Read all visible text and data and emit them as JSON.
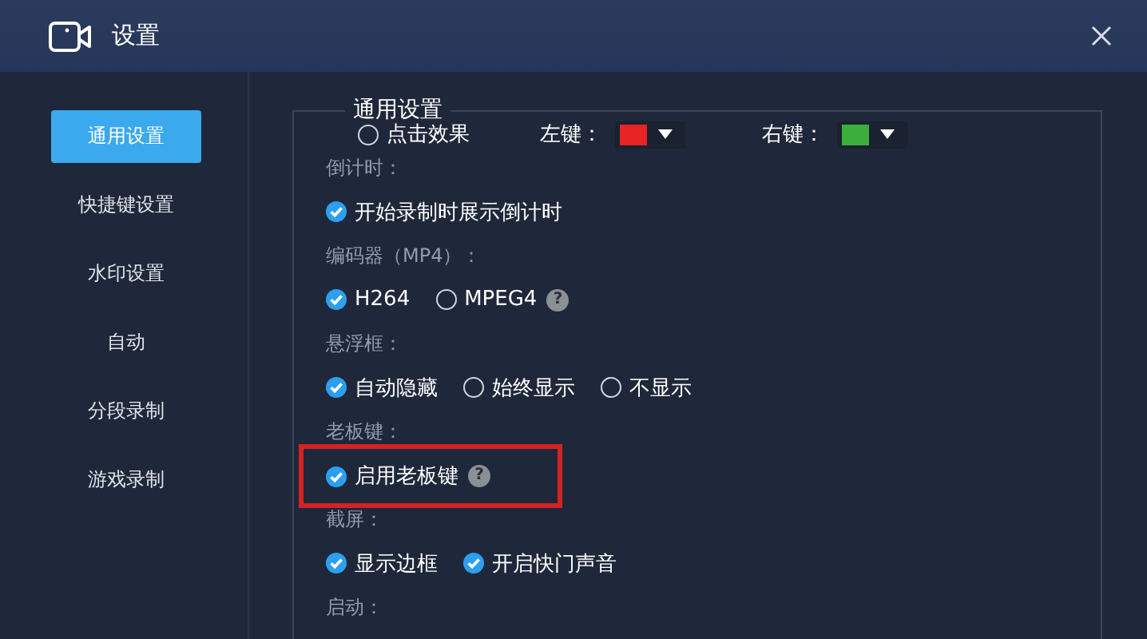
{
  "window": {
    "title": "设置"
  },
  "sidebar": {
    "items": [
      {
        "label": "通用设置",
        "selected": true
      },
      {
        "label": "快捷键设置",
        "selected": false
      },
      {
        "label": "水印设置",
        "selected": false
      },
      {
        "label": "自动",
        "selected": false
      },
      {
        "label": "分段录制",
        "selected": false
      },
      {
        "label": "游戏录制",
        "selected": false
      }
    ]
  },
  "panel": {
    "title": "通用设置",
    "click_effect": {
      "label": "点击效果",
      "checked": false,
      "pickers": [
        {
          "label": "左键：",
          "color": "#e82424"
        },
        {
          "label": "右键：",
          "color": "#3cae3c"
        }
      ]
    },
    "sections": [
      {
        "label": "倒计时：",
        "highlighted": false,
        "options": [
          {
            "label": "开始录制时展示倒计时",
            "checked": true
          }
        ]
      },
      {
        "label": "编码器（MP4）：",
        "highlighted": false,
        "options": [
          {
            "label": "H264",
            "checked": true
          },
          {
            "label": "MPEG4",
            "checked": false,
            "help": "?"
          }
        ]
      },
      {
        "label": "悬浮框：",
        "highlighted": false,
        "options": [
          {
            "label": "自动隐藏",
            "checked": true
          },
          {
            "label": "始终显示",
            "checked": false
          },
          {
            "label": "不显示",
            "checked": false
          }
        ]
      },
      {
        "label": "老板键：",
        "highlighted": true,
        "options": [
          {
            "label": "启用老板键",
            "checked": true,
            "help": "?"
          }
        ]
      },
      {
        "label": "截屏：",
        "highlighted": false,
        "options": [
          {
            "label": "显示边框",
            "checked": true
          },
          {
            "label": "开启快门声音",
            "checked": true
          }
        ]
      },
      {
        "label": "启动："
      }
    ]
  }
}
